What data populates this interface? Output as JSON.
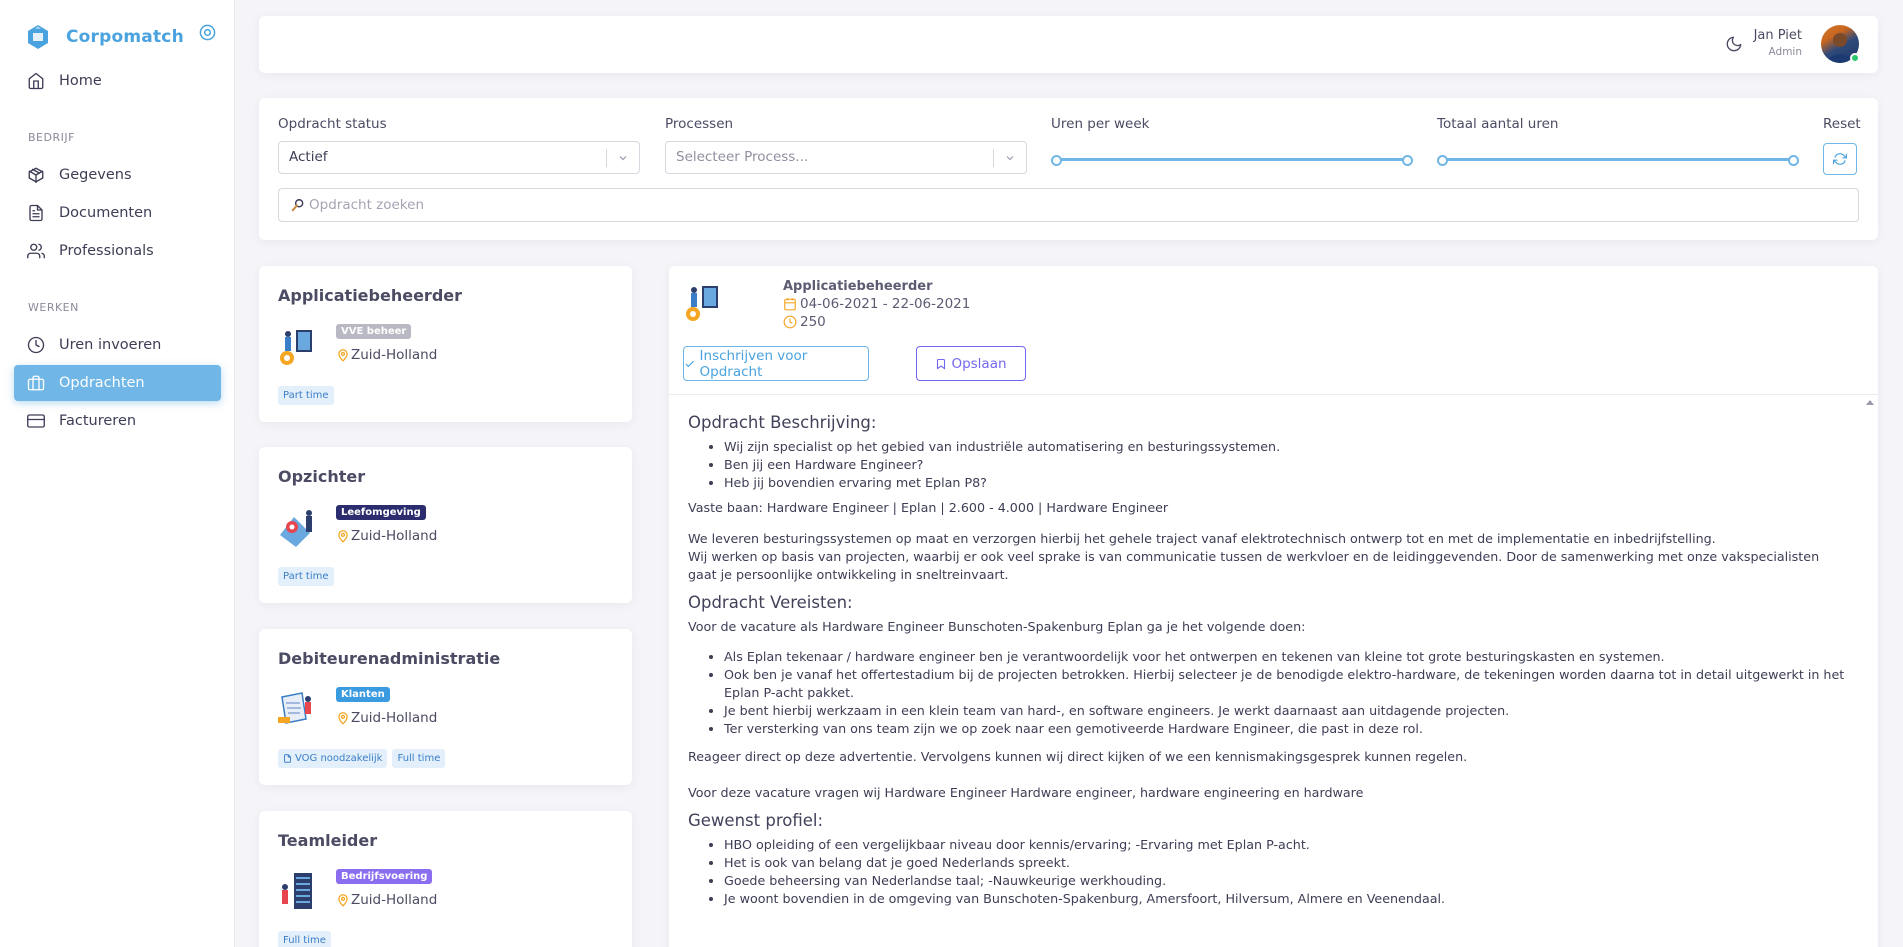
{
  "app": {
    "brand": "Corpomatch"
  },
  "sidebar": {
    "home": "Home",
    "section_bedrijf": "BEDRIJF",
    "section_werken": "WERKEN",
    "items": [
      {
        "label": "Gegevens"
      },
      {
        "label": "Documenten"
      },
      {
        "label": "Professionals"
      },
      {
        "label": "Uren invoeren"
      },
      {
        "label": "Opdrachten"
      },
      {
        "label": "Factureren"
      }
    ]
  },
  "user": {
    "name": "Jan Piet",
    "role": "Admin"
  },
  "filters": {
    "status_label": "Opdracht status",
    "status_value": "Actief",
    "process_label": "Processen",
    "process_placeholder": "Selecteer Process...",
    "hours_week_label": "Uren per week",
    "hours_total_label": "Totaal aantal uren",
    "reset_label": "Reset",
    "search_placeholder": "Opdracht zoeken",
    "hours_week_range": [
      0,
      1
    ],
    "hours_total_range": [
      0,
      1
    ]
  },
  "jobs": [
    {
      "title": "Applicatiebeheerder",
      "category": "VVE beheer",
      "category_color": "#b9b9c3",
      "location": "Zuid-Holland",
      "tags": [
        "Part time"
      ]
    },
    {
      "title": "Opzichter",
      "category": "Leefomgeving",
      "category_color": "#2c2d6e",
      "location": "Zuid-Holland",
      "tags": [
        "Part time"
      ]
    },
    {
      "title": "Debiteurenadministratie",
      "category": "Klanten",
      "category_color": "#3b9be0",
      "location": "Zuid-Holland",
      "tags": [
        "VOG noodzakelijk",
        "Full time"
      ]
    },
    {
      "title": "Teamleider",
      "category": "Bedrijfsvoering",
      "category_color": "#8b6ef0",
      "location": "Zuid-Holland",
      "tags": [
        "Full time"
      ]
    }
  ],
  "detail": {
    "title": "Applicatiebeheerder",
    "dates": "04-06-2021 - 22-06-2021",
    "hours": "250",
    "apply_label": "Inschrijven voor Opdracht",
    "save_label": "Opslaan",
    "h_description": "Opdracht Beschrijving:",
    "desc_items": [
      "Wij zijn specialist op het gebied van industriële automatisering en besturingssystemen.",
      "Ben jij een Hardware Engineer?",
      "Heb jij bovendien ervaring met Eplan P8?"
    ],
    "p_vaste": "Vaste baan: Hardware Engineer | Eplan | 2.600 - 4.000 | Hardware Engineer",
    "p_leveren_1": "We leveren besturingssystemen op maat en verzorgen hierbij het gehele traject vanaf elektrotechnisch ontwerp tot en met de implementatie en inbedrijfstelling.",
    "p_leveren_2": "Wij werken op basis van projecten, waarbij er ook veel sprake is van communicatie tussen de werkvloer en de leidinggevenden. Door de samenwerking met onze vakspecialisten gaat je persoonlijke ontwikkeling in sneltreinvaart.",
    "h_requirements": "Opdracht Vereisten:",
    "p_vacature": "Voor de vacature als Hardware Engineer Bunschoten-Spakenburg Eplan ga je het volgende doen:",
    "req_items": [
      "Als Eplan tekenaar / hardware engineer ben je verantwoordelijk voor het ontwerpen en tekenen van kleine tot grote besturingskasten en systemen.",
      "Ook ben je vanaf het offertestadium bij de projecten betrokken. Hierbij selecteer je de benodigde elektro-hardware, de tekeningen worden daarna tot in detail uitgewerkt in het Eplan P-acht pakket.",
      "Je bent hierbij werkzaam in een klein team van hard-, en software engineers. Je werkt daarnaast aan uitdagende projecten.",
      "Ter versterking van ons team zijn we op zoek naar een gemotiveerde Hardware Engineer, die past in deze rol."
    ],
    "p_reageer": "Reageer direct op deze advertentie. Vervolgens kunnen wij direct kijken of we een kennismakingsgesprek kunnen regelen.",
    "p_vragen": "Voor deze vacature vragen wij Hardware Engineer Hardware engineer, hardware engineering en hardware",
    "h_profile": "Gewenst profiel:",
    "profile_items": [
      "HBO opleiding of een vergelijkbaar niveau door kennis/ervaring; -Ervaring met Eplan P-acht.",
      "Het is ook van belang dat je goed Nederlands spreekt.",
      "Goede beheersing van Nederlandse taal; -Nauwkeurige werkhouding.",
      "Je woont bovendien in de omgeving van Bunschoten-Spakenburg, Amersfoort, Hilversum, Almere en Veenendaal."
    ]
  },
  "colors": {
    "accent": "#70b6e6",
    "brand": "#4aa3df",
    "purple": "#7367f0",
    "marker": "#f5a623"
  }
}
